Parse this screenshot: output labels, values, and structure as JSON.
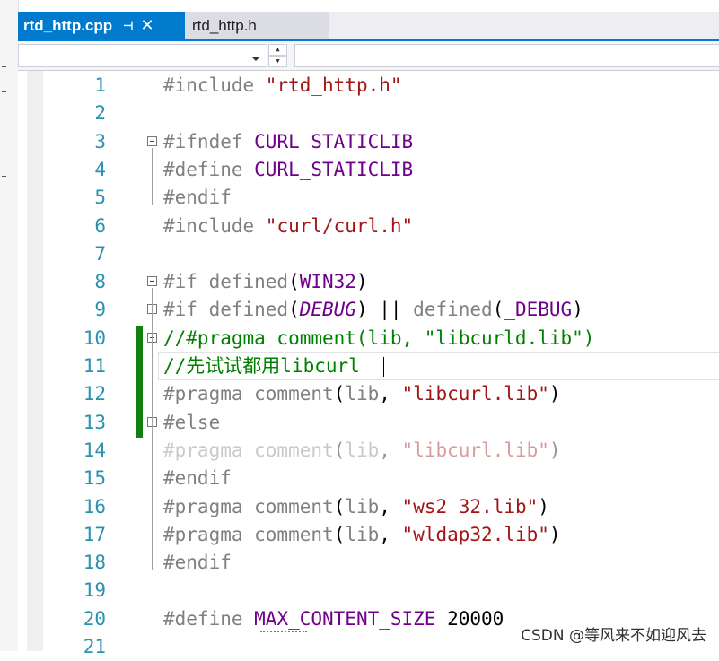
{
  "tabs": [
    {
      "label": "rtd_http.cpp",
      "active": true,
      "pin_icon": "pin-icon",
      "close_icon": "close-icon"
    },
    {
      "label": "rtd_http.h",
      "active": false
    }
  ],
  "navbar": {
    "dropdown_value": "",
    "right_value": ""
  },
  "lines": [
    {
      "num": "1",
      "segs": [
        [
          "#include ",
          "kw"
        ],
        [
          "\"rtd_http.h\"",
          "str"
        ]
      ]
    },
    {
      "num": "2",
      "segs": []
    },
    {
      "num": "3",
      "fold": true,
      "segs": [
        [
          "#ifndef ",
          "kw"
        ],
        [
          "CURL_STATICLIB",
          "mac"
        ]
      ]
    },
    {
      "num": "4",
      "segs": [
        [
          "#define ",
          "kw"
        ],
        [
          "CURL_STATICLIB",
          "mac"
        ]
      ]
    },
    {
      "num": "5",
      "segs": [
        [
          "#endif",
          "kw"
        ]
      ]
    },
    {
      "num": "6",
      "segs": [
        [
          "#include ",
          "kw"
        ],
        [
          "\"curl/curl.h\"",
          "str"
        ]
      ]
    },
    {
      "num": "7",
      "segs": []
    },
    {
      "num": "8",
      "fold": true,
      "segs": [
        [
          "#if defined",
          "kw"
        ],
        [
          "(",
          "pl"
        ],
        [
          "WIN32",
          "mac"
        ],
        [
          ")",
          "pl"
        ]
      ]
    },
    {
      "num": "9",
      "fold": true,
      "segs": [
        [
          "#if defined",
          "kw"
        ],
        [
          "(",
          "pl"
        ],
        [
          "DEBUG",
          "mac it"
        ],
        [
          ") || ",
          "pl"
        ],
        [
          "defined",
          "kw"
        ],
        [
          "(",
          "pl"
        ],
        [
          "_DEBUG",
          "mac"
        ],
        [
          ")",
          "pl"
        ]
      ]
    },
    {
      "num": "10",
      "fold": true,
      "segs": [
        [
          "//#pragma comment(lib, \"libcurld.lib\")",
          "cm"
        ]
      ]
    },
    {
      "num": "11",
      "segs": [
        [
          "//先试试都用libcurl",
          "cm"
        ]
      ]
    },
    {
      "num": "12",
      "segs": [
        [
          "#pragma comment",
          "kw"
        ],
        [
          "(",
          "pl"
        ],
        [
          "lib",
          "kw"
        ],
        [
          ", ",
          "pl"
        ],
        [
          "\"libcurl.lib\"",
          "str"
        ],
        [
          ")",
          "pl"
        ]
      ]
    },
    {
      "num": "13",
      "fold": true,
      "segs": [
        [
          "#else",
          "kw"
        ]
      ]
    },
    {
      "num": "14",
      "dim": true,
      "segs": [
        [
          "#pragma comment",
          "kw"
        ],
        [
          "(",
          "pl"
        ],
        [
          "lib",
          "kw"
        ],
        [
          ", ",
          "pl"
        ],
        [
          "\"libcurl.lib\"",
          "str"
        ],
        [
          ")",
          "pl"
        ]
      ]
    },
    {
      "num": "15",
      "segs": [
        [
          "#endif",
          "kw"
        ]
      ]
    },
    {
      "num": "16",
      "segs": [
        [
          "#pragma comment",
          "kw"
        ],
        [
          "(",
          "pl"
        ],
        [
          "lib",
          "kw"
        ],
        [
          ", ",
          "pl"
        ],
        [
          "\"ws2_32.lib\"",
          "str"
        ],
        [
          ")",
          "pl"
        ]
      ]
    },
    {
      "num": "17",
      "segs": [
        [
          "#pragma comment",
          "kw"
        ],
        [
          "(",
          "pl"
        ],
        [
          "lib",
          "kw"
        ],
        [
          ", ",
          "pl"
        ],
        [
          "\"wldap32.lib\"",
          "str"
        ],
        [
          ")",
          "pl"
        ]
      ]
    },
    {
      "num": "18",
      "segs": [
        [
          "#endif",
          "kw"
        ]
      ]
    },
    {
      "num": "19",
      "segs": []
    },
    {
      "num": "20",
      "segs": [
        [
          "#define ",
          "kw"
        ],
        [
          "MAX_CONTENT_SIZE",
          "mac"
        ],
        [
          " 20000",
          "pl"
        ]
      ]
    },
    {
      "num": "21",
      "segs": []
    }
  ],
  "watermark": "CSDN @等风来不如迎风去",
  "colors": {
    "accent": "#007acc",
    "line_number": "#2b91af",
    "macro": "#6f008a",
    "string": "#a31515",
    "comment": "#008000",
    "preprocessor": "#808080",
    "change_bar": "#108010"
  }
}
